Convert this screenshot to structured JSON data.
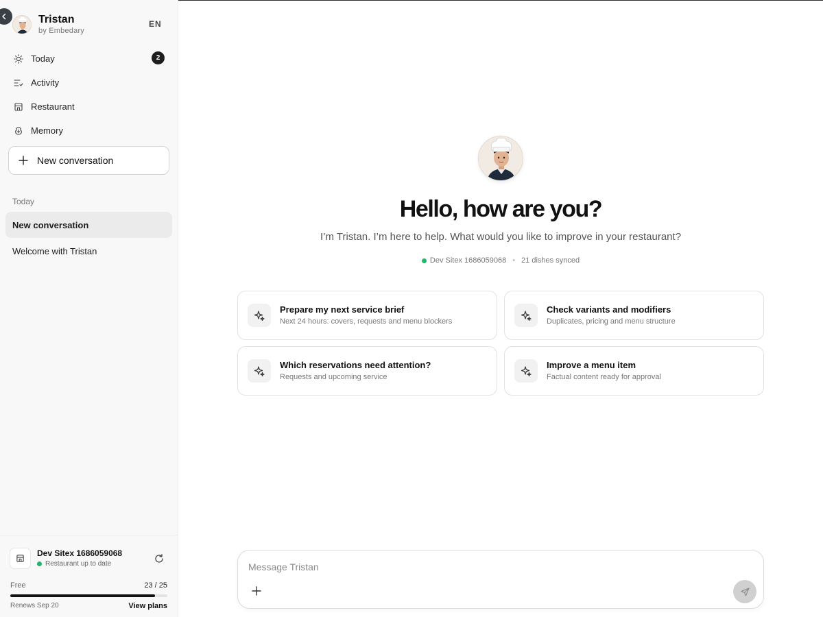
{
  "profile": {
    "name": "Tristan",
    "subtitle": "by Embedary",
    "language": "EN"
  },
  "nav": {
    "items": [
      {
        "label": "Today",
        "icon": "sun-icon",
        "badge": "2"
      },
      {
        "label": "Activity",
        "icon": "activity-list-icon"
      },
      {
        "label": "Restaurant",
        "icon": "store-icon"
      },
      {
        "label": "Memory",
        "icon": "memory-icon"
      }
    ]
  },
  "new_conversation_label": "New conversation",
  "history": {
    "section_label": "Today",
    "items": [
      {
        "label": "New conversation",
        "active": true
      },
      {
        "label": "Welcome with Tristan",
        "active": false
      }
    ]
  },
  "footer": {
    "site_name": "Dev Sitex 1686059068",
    "site_status": "Restaurant up to date",
    "plan_name": "Free",
    "usage_label": "23 / 25",
    "usage_fraction": 0.92,
    "renews": "Renews Sep 20",
    "view_plans": "View plans"
  },
  "main": {
    "greeting": "Hello, how are you?",
    "intro": "I’m Tristan. I’m here to help. What would you like to improve in your restaurant?",
    "site_meta": "Dev Sitex 1686059068",
    "sync_meta": "21 dishes synced",
    "meta_separator": "•",
    "suggestions": [
      {
        "title": "Prepare my next service brief",
        "subtitle": "Next 24 hours: covers, requests and menu blockers"
      },
      {
        "title": "Check variants and modifiers",
        "subtitle": "Duplicates, pricing and menu structure"
      },
      {
        "title": "Which reservations need attention?",
        "subtitle": "Requests and upcoming service"
      },
      {
        "title": "Improve a menu item",
        "subtitle": "Factual content ready for approval"
      }
    ]
  },
  "composer": {
    "placeholder": "Message Tristan",
    "value": ""
  },
  "colors": {
    "accent": "#111111",
    "status_green": "#22b46a",
    "sidebar_bg": "#f8f8f8"
  }
}
